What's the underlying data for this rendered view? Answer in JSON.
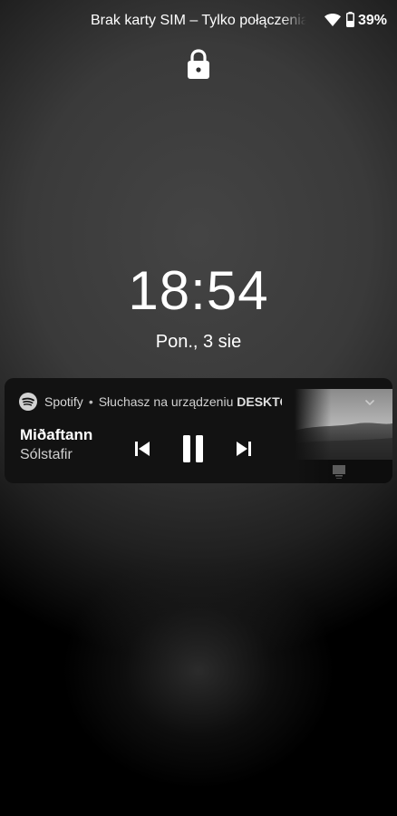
{
  "status_bar": {
    "carrier_text": "Brak karty SIM – Tylko połączenia alarmowe",
    "battery_percent": "39%",
    "battery_level": 0.39,
    "icons": [
      "wifi-icon",
      "battery-icon"
    ]
  },
  "lock_screen": {
    "icon": "lock-icon",
    "time": "18:54",
    "date": "Pon., 3 sie"
  },
  "media_notification": {
    "app_name": "Spotify",
    "separator": "•",
    "playing_on": "Słuchasz na urządzeniu",
    "device_name": "DESKTO...",
    "track_title": "Miðaftann",
    "artist": "Sólstafir",
    "controls": [
      "skip-previous-icon",
      "pause-icon",
      "skip-next-icon"
    ],
    "expand_icon": "chevron-down-icon",
    "colors": {
      "card_background": "#121212",
      "text_primary": "#ffffff",
      "text_secondary": "#cfcfcf"
    }
  }
}
